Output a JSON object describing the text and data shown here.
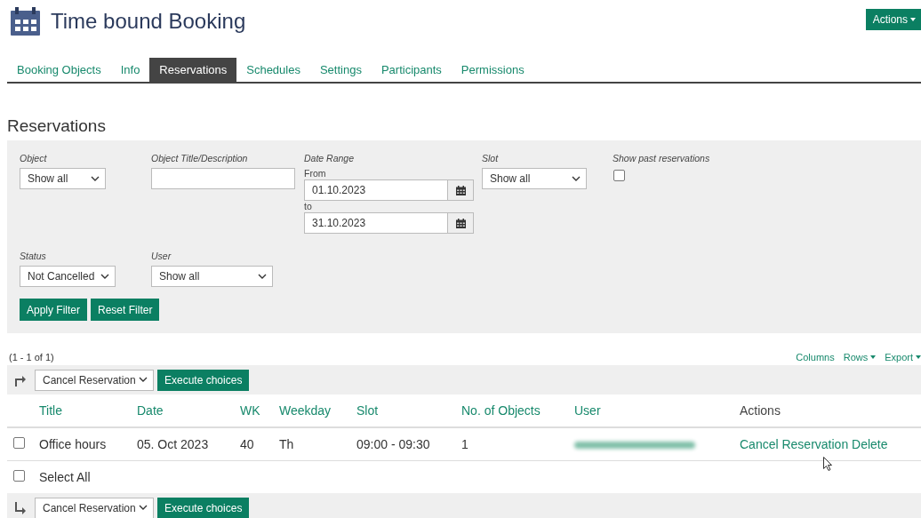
{
  "header": {
    "title": "Time bound Booking",
    "actions_button": "Actions"
  },
  "tabs": [
    {
      "label": "Booking Objects",
      "selected": false
    },
    {
      "label": "Info",
      "selected": false
    },
    {
      "label": "Reservations",
      "selected": true
    },
    {
      "label": "Schedules",
      "selected": false
    },
    {
      "label": "Settings",
      "selected": false
    },
    {
      "label": "Participants",
      "selected": false
    },
    {
      "label": "Permissions",
      "selected": false
    }
  ],
  "section_title": "Reservations",
  "filter_rows": [
    [
      {
        "kind": "select",
        "label": "Object",
        "value": "Show all"
      },
      {
        "kind": "text",
        "label": "Object Title/Description"
      },
      {
        "kind": "daterange",
        "label": "Date Range",
        "from_label": "From",
        "from": "01.10.2023",
        "to_label": "to",
        "to": "31.10.2023"
      },
      {
        "kind": "select",
        "label": "Slot",
        "value": "Show all"
      },
      {
        "kind": "checkbox",
        "label": "Show past reservations",
        "checked": false
      }
    ],
    [
      {
        "kind": "select",
        "label": "Status",
        "value": "Not Cancelled"
      },
      {
        "kind": "select",
        "label": "User",
        "value": "Show all"
      }
    ]
  ],
  "filter_buttons": [
    "Apply Filter",
    "Reset Filter"
  ],
  "table": {
    "range": "(1 - 1 of 1)",
    "tools": [
      {
        "label": "Columns",
        "dropdown": false
      },
      {
        "label": "Rows",
        "dropdown": true
      },
      {
        "label": "Export",
        "dropdown": true
      }
    ],
    "command_bars": [
      {
        "kind": "top",
        "select": "Cancel Reservation",
        "button": "Execute choices"
      },
      {
        "kind": "bottom",
        "select": "Cancel Reservation",
        "button": "Execute choices"
      }
    ],
    "columns": [
      {
        "label": "Title",
        "sortable": true
      },
      {
        "label": "Date",
        "sortable": true
      },
      {
        "label": "WK",
        "sortable": true
      },
      {
        "label": "Weekday",
        "sortable": true
      },
      {
        "label": "Slot",
        "sortable": true
      },
      {
        "label": "No. of Objects",
        "sortable": true
      },
      {
        "label": "User",
        "sortable": true
      },
      {
        "label": "Actions",
        "sortable": false
      }
    ],
    "rows": [
      {
        "checked": false,
        "title": "Office hours",
        "date": "05. Oct 2023",
        "wk": "40",
        "weekday": "Th",
        "slot": "09:00 - 09:30",
        "objects": "1",
        "actions": [
          "Cancel Reservation",
          "Delete"
        ]
      }
    ],
    "select_all": {
      "label": "Select All",
      "checked": false
    }
  }
}
